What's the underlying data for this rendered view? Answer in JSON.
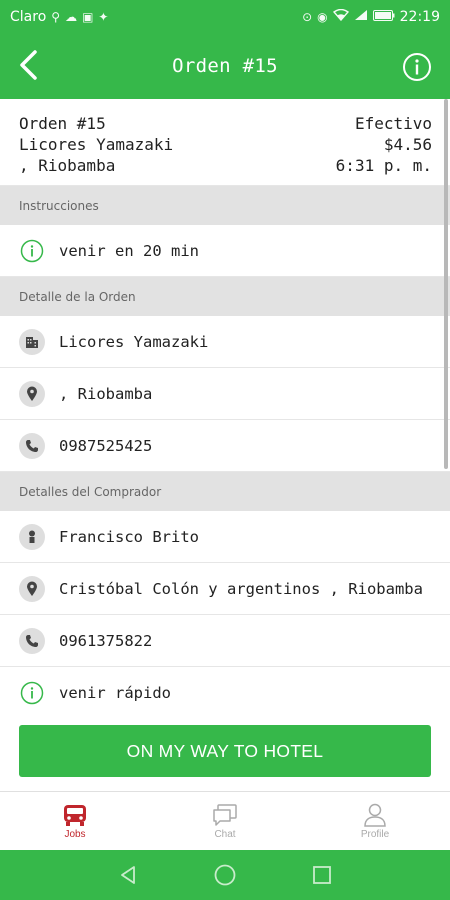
{
  "status_bar": {
    "carrier": "Claro",
    "time": "22:19",
    "icons_left": [
      "usb-icon",
      "cloud-icon",
      "gallery-icon",
      "twitter-icon"
    ],
    "icons_right": [
      "location-icon",
      "eye-icon",
      "wifi-icon",
      "signal-icon",
      "battery-icon"
    ]
  },
  "app_bar": {
    "title": "Orden #15"
  },
  "summary": {
    "order_label": "Orden #15",
    "store_name": "Licores Yamazaki",
    "location": ", Riobamba",
    "payment_method": "Efectivo",
    "amount": "$4.56",
    "time": "6:31 p. m."
  },
  "sections": {
    "instructions": {
      "header": "Instrucciones",
      "text": "venir en 20 min"
    },
    "order_detail": {
      "header": "Detalle de la Orden",
      "store": "Licores Yamazaki",
      "address": ", Riobamba",
      "phone": "0987525425"
    },
    "buyer_detail": {
      "header": "Detalles del Comprador",
      "name": "Francisco Brito",
      "address": "Cristóbal Colón y argentinos , Riobamba",
      "phone": "0961375822",
      "note": "venir rápido"
    }
  },
  "cta": {
    "label": "ON MY WAY TO HOTEL"
  },
  "bottom_nav": {
    "items": [
      {
        "label": "Jobs",
        "icon": "bus-icon",
        "active": true
      },
      {
        "label": "Chat",
        "icon": "chat-icon",
        "active": false
      },
      {
        "label": "Profile",
        "icon": "profile-icon",
        "active": false
      }
    ]
  },
  "colors": {
    "primary": "#36b84a",
    "active_tab": "#c0262c",
    "section_bg": "#e2e2e2"
  }
}
